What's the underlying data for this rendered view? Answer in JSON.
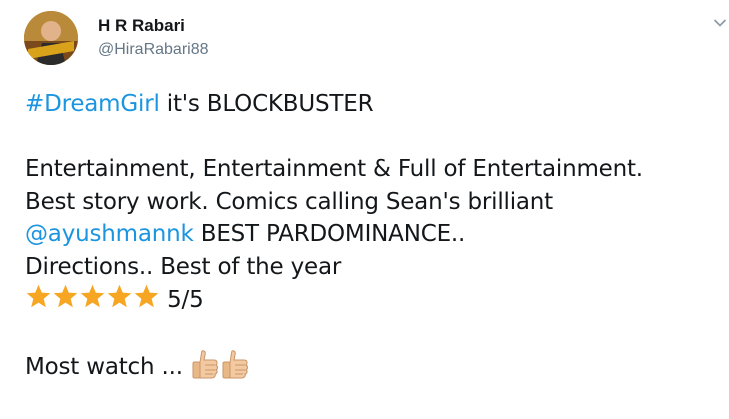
{
  "author": {
    "name": "H R Rabari",
    "handle": "@HiraRabari88"
  },
  "tweet": {
    "line1": {
      "hashtag": "#DreamGirl",
      "text": " it's BLOCKBUSTER"
    },
    "line2": " Entertainment, Entertainment & Full of Entertainment.",
    "line3": "Best story work. Comics calling Sean's brilliant",
    "line4": {
      "lead": " ",
      "mention": "@ayushmannk",
      "text": " BEST PARDOMINANCE.."
    },
    "line5": "Directions.. Best of the year",
    "rating": {
      "stars": 5,
      "text": "5/5",
      "star_color": "#f6a623"
    },
    "closing": "Most watch ... ",
    "closing_emoji": [
      "thumbs-up-icon",
      "thumbs-up-icon"
    ]
  },
  "colors": {
    "link": "#1b95e0",
    "handle": "#657786",
    "text": "#14171a"
  },
  "icons": {
    "menu": "chevron-down-icon"
  }
}
